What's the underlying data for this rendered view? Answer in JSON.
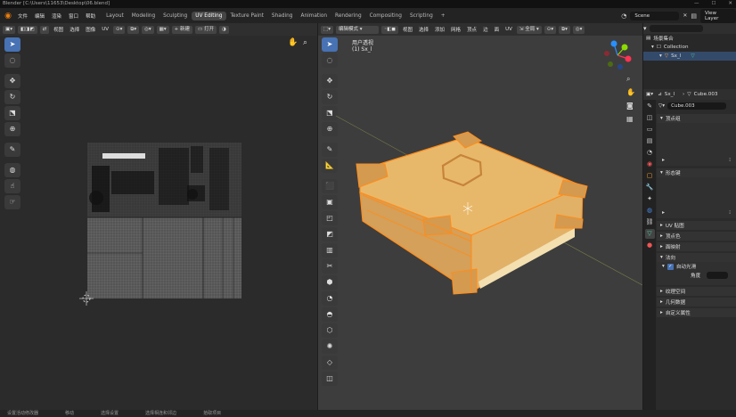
{
  "window": {
    "title": "Blender [C:\\Users\\11653\\Desktop\\06.blend]",
    "controls": [
      "—",
      "☐",
      "✕"
    ]
  },
  "menu": [
    "文件",
    "编辑",
    "渲染",
    "窗口",
    "帮助"
  ],
  "workspaces": [
    "Layout",
    "Modeling",
    "Sculpting",
    "UV Editing",
    "Texture Paint",
    "Shading",
    "Animation",
    "Rendering",
    "Compositing",
    "Scripting",
    "+"
  ],
  "active_workspace": "UV Editing",
  "scene": {
    "name": "Scene",
    "view_layer": "View Layer"
  },
  "uv_editor": {
    "header": {
      "view": "视图",
      "select": "选择",
      "image": "图像",
      "uv": "UV",
      "new": "新建",
      "open": "打开"
    }
  },
  "viewport": {
    "header": {
      "mode": "编辑模式",
      "view": "视图",
      "select": "选择",
      "add": "添加",
      "mesh": "网格",
      "vertex": "顶点",
      "edge": "边",
      "face": "面",
      "uv": "UV",
      "orientation": "全局"
    },
    "overlay_title": "用户透视",
    "overlay_object": "(1) Sx_l",
    "gizmo": {
      "x": "X",
      "y": "Y",
      "z": "Z"
    }
  },
  "outliner": {
    "title": "场景集合",
    "collection": "Collection",
    "object": "Sx_l"
  },
  "properties": {
    "object": "Sx_l",
    "mesh": "Cube.003",
    "data_name": "Cube.003",
    "panels": [
      "顶点组",
      "形态键",
      "UV 贴图",
      "顶点色",
      "面映射",
      "法向",
      "纹理空间",
      "几何数据",
      "自定义属性"
    ],
    "auto_smooth": "自动光滑",
    "angle_label": "角度"
  },
  "status": [
    "设置活动修改器",
    "移动",
    "选择设置",
    "选择相连和邻边",
    "拾取项目"
  ],
  "colors": {
    "accent": "#4772b3",
    "object_orange": "#e8b86a",
    "edge_orange": "#ff8c1a"
  }
}
